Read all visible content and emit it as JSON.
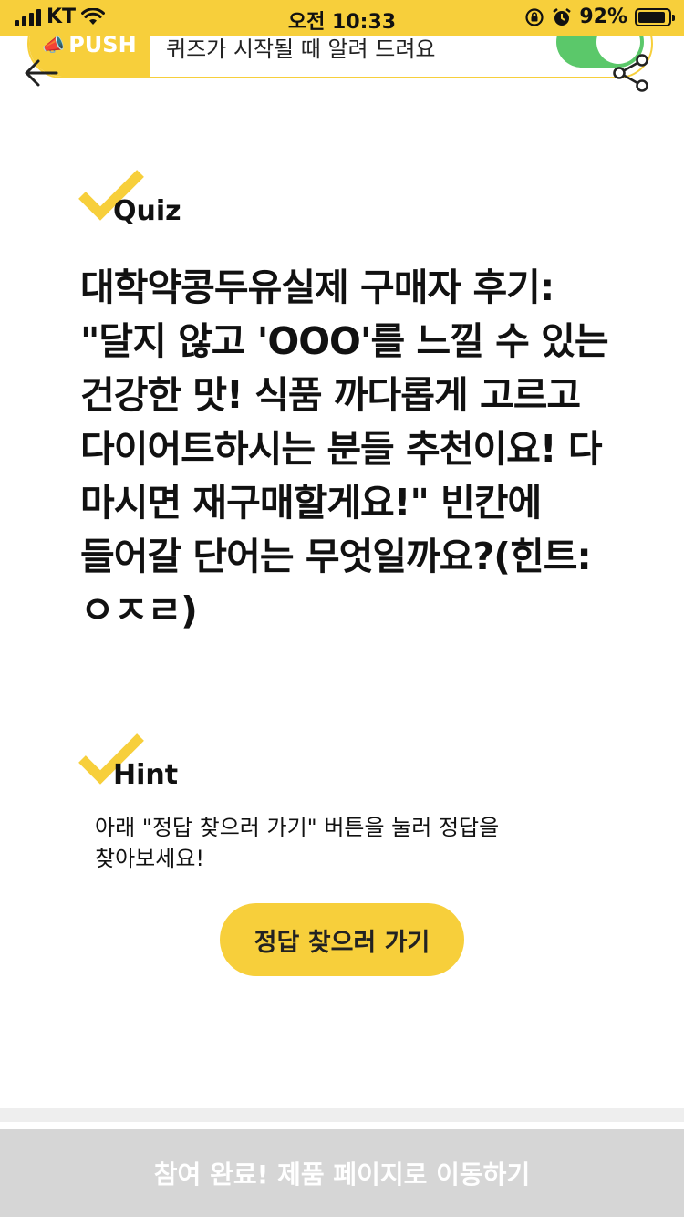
{
  "status_bar": {
    "carrier": "KT",
    "time": "오전 10:33",
    "battery_percent": "92%",
    "battery_level": 0.92
  },
  "push_banner": {
    "label": "PUSH",
    "text": "퀴즈가 시작될 때 알려 드려요",
    "toggle_on": true,
    "accent_color": "#f7cf3b",
    "toggle_color": "#5bc86a"
  },
  "quiz": {
    "label": "Quiz",
    "question": "대학약콩두유실제 구매자 후기: \"달지 않고 'OOO'를 느낄 수 있는 건강한 맛! 식품 까다롭게 고르고 다이어트하시는 분들 추천이요! 다 마시면 재구매할게요!\" 빈칸에 들어갈 단어는 무엇일까요?(힌트: ㅇㅈㄹ)"
  },
  "hint": {
    "label": "Hint",
    "text": "아래 \"정답 찾으러 가기\" 버튼을 눌러 정답을 찾아보세요!",
    "button_label": "정답 찾으러 가기"
  },
  "footer": {
    "button_label": "참여 완료! 제품 페이지로 이동하기"
  },
  "icons": [
    "back-arrow-icon",
    "share-icon",
    "checkmark-icon",
    "wifi-icon",
    "alarm-icon",
    "rotation-lock-icon",
    "megaphone-icon"
  ]
}
